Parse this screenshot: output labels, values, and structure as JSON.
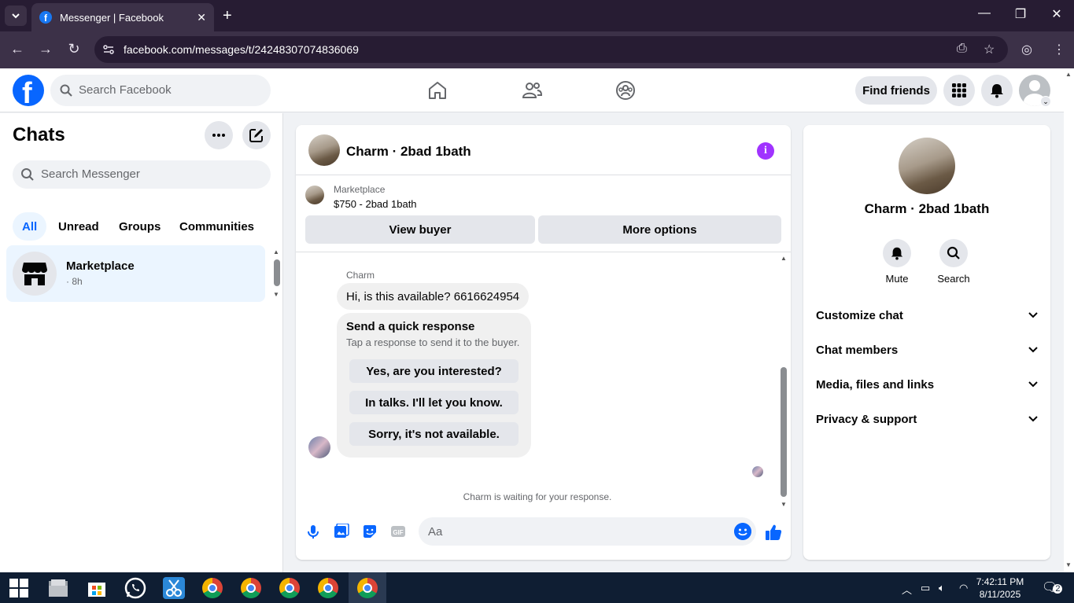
{
  "browser": {
    "tab_title": "Messenger | Facebook",
    "url": "facebook.com/messages/t/24248307074836069"
  },
  "header": {
    "search_placeholder": "Search Facebook",
    "find_friends": "Find friends"
  },
  "chats": {
    "title": "Chats",
    "search_placeholder": "Search Messenger",
    "filters": [
      "All",
      "Unread",
      "Groups",
      "Communities"
    ],
    "items": [
      {
        "name": "Marketplace",
        "time": "· 8h"
      }
    ]
  },
  "conversation": {
    "title": "Charm · 2bad 1bath",
    "marketplace_label": "Marketplace",
    "listing": "$750 - 2bad 1bath",
    "view_buyer": "View buyer",
    "more_options": "More options",
    "sender": "Charm",
    "message": "Hi, is this available? 6616624954",
    "quick_title": "Send a quick response",
    "quick_subtitle": "Tap a response to send it to the buyer.",
    "quick_responses": [
      "Yes, are you interested?",
      "In talks. I'll let you know.",
      "Sorry, it's not available."
    ],
    "waiting": "Charm is waiting for your response.",
    "composer_placeholder": "Aa"
  },
  "info_panel": {
    "name": "Charm · 2bad 1bath",
    "mute": "Mute",
    "search": "Search",
    "sections": [
      "Customize chat",
      "Chat members",
      "Media, files and links",
      "Privacy & support"
    ]
  },
  "taskbar": {
    "time": "7:42:11 PM",
    "date": "8/11/2025",
    "notifications": "2"
  },
  "colors": {
    "brand": "#0866ff",
    "accent_purple": "#a033ff",
    "selected_chat_bg": "#ebf5ff"
  }
}
